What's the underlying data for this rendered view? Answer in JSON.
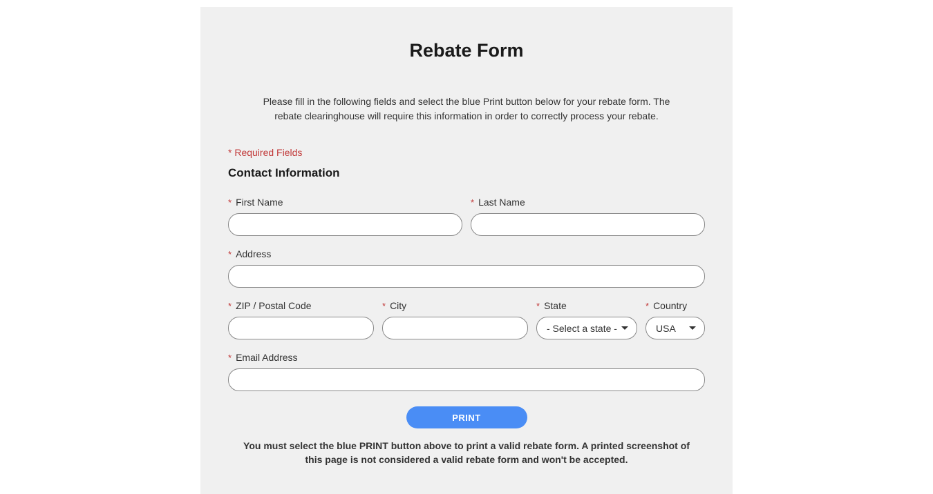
{
  "title": "Rebate Form",
  "instructions": "Please fill in the following fields and select the blue Print button below for your rebate form. The rebate clearinghouse will require this information in order to correctly process your rebate.",
  "required_note": "* Required Fields",
  "section": "Contact Information",
  "asterisk": "*",
  "fields": {
    "first_name": {
      "label": "First Name",
      "value": ""
    },
    "last_name": {
      "label": "Last Name",
      "value": ""
    },
    "address": {
      "label": "Address",
      "value": ""
    },
    "zip": {
      "label": "ZIP / Postal Code",
      "value": ""
    },
    "city": {
      "label": "City",
      "value": ""
    },
    "state": {
      "label": "State",
      "placeholder": "- Select a state -"
    },
    "country": {
      "label": "Country",
      "selected": "USA"
    },
    "email": {
      "label": "Email Address",
      "value": ""
    }
  },
  "print_button": "PRINT",
  "warning": "You must select the blue PRINT button above to print a valid rebate form. A printed screenshot of this page is not considered a valid rebate form and won't be accepted."
}
